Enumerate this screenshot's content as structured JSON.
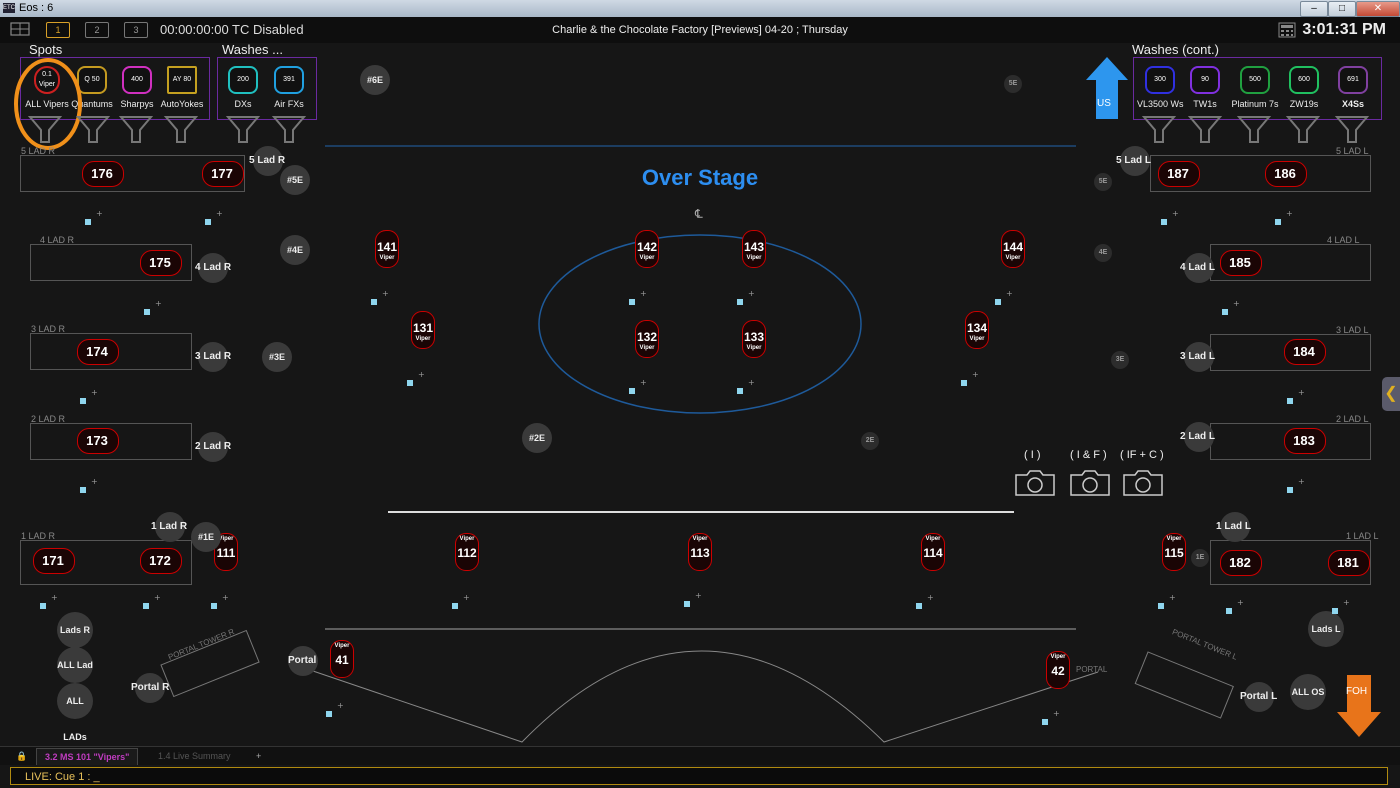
{
  "window": {
    "title": "Eos : 6",
    "logo": "ETC",
    "min_glyph": "–",
    "max_glyph": "□",
    "close_glyph": "✕"
  },
  "toolbar": {
    "tab1": "1",
    "tab2": "2",
    "tab3": "3",
    "timecode": "00:00:00:00 TC Disabled",
    "show_title": "Charlie & the Chocolate Factory [Previews] 04-20 ; Thursday",
    "clock": "3:01:31 PM"
  },
  "spots": {
    "header": "Spots",
    "items": [
      {
        "label": "ALL Vipers",
        "icon": "0.1\nViper",
        "color": "#cc2020"
      },
      {
        "label": "Quantums",
        "icon": "Q 50",
        "color": "#c49a20"
      },
      {
        "label": "Sharpys",
        "icon": "400",
        "color": "#d030c0"
      },
      {
        "label": "AutoYokes",
        "icon": "AY 80",
        "color": "#c4a020"
      }
    ]
  },
  "washes": {
    "header": "Washes ...",
    "items": [
      {
        "label": "DXs",
        "icon": "200 DX",
        "color": "#20c0c0"
      },
      {
        "label": "Air FXs",
        "icon": "391 Air FX",
        "color": "#20a0e0"
      }
    ]
  },
  "washes_cont": {
    "header": "Washes (cont.)",
    "items": [
      {
        "label": "VL3500 Ws",
        "icon": "300",
        "color": "#3030e0"
      },
      {
        "label": "TW1s",
        "icon": "TW1 90",
        "color": "#8030e0"
      },
      {
        "label": "Platinum 7s",
        "icon": "500",
        "color": "#20a040"
      },
      {
        "label": "ZW19s",
        "icon": "600 ZW",
        "color": "#20c060"
      },
      {
        "label": "X4Ss",
        "icon": "691",
        "color": "#8040a0"
      }
    ]
  },
  "stage": {
    "title": "Over Stage",
    "centerline": "℄",
    "us_label": "US",
    "foh_label": "FOH",
    "portal_tower_r": "PORTAL TOWER R",
    "portal_tower_l": "PORTAL TOWER L",
    "portal_text": "PORTAL",
    "collapse_glyph": "❮"
  },
  "ladders": {
    "r": [
      "5 LAD R",
      "4 LAD R",
      "3 LAD R",
      "2 LAD R",
      "1 LAD R"
    ],
    "l": [
      "5 LAD L",
      "4 LAD L",
      "3 LAD L",
      "2 LAD L",
      "1 LAD L"
    ]
  },
  "fixtures": {
    "f176": "176",
    "f177": "177",
    "f175": "175",
    "f174": "174",
    "f173": "173",
    "f171": "171",
    "f172": "172",
    "f187": "187",
    "f186": "186",
    "f185": "185",
    "f184": "184",
    "f183": "183",
    "f182": "182",
    "f181": "181",
    "f141": "141",
    "f142": "142",
    "f143": "143",
    "f144": "144",
    "f131": "131",
    "f132": "132",
    "f133": "133",
    "f134": "134",
    "f111": "111",
    "f112": "112",
    "f113": "113",
    "f114": "114",
    "f115": "115",
    "f41": "41",
    "f42": "42",
    "type": "Viper"
  },
  "groups": {
    "lad5r": "5 Lad R",
    "lad4r": "4 Lad R",
    "lad3r": "3 Lad R",
    "lad2r": "2 Lad R",
    "lad1r": "1 Lad R",
    "lad5l": "5 Lad L",
    "lad4l": "4 Lad L",
    "lad3l": "3 Lad L",
    "lad2l": "2 Lad L",
    "lad1l": "1 Lad L",
    "e6": "#6E",
    "e5": "#5E",
    "e4": "#4E",
    "e3": "#3E",
    "e2": "#2E",
    "e1": "#1E",
    "e6b": "5E",
    "e5b": "5E",
    "e4b": "4E",
    "e3b": "3E",
    "e2b": "2E",
    "e1b": "1E",
    "lads_r": "Lads R",
    "all_lad_v": "ALL Lad V",
    "all_lads": "ALL LADs",
    "portal_r": "Portal R",
    "portal": "Portal",
    "lads_l": "Lads L",
    "all_os": "ALL OS",
    "portal_l": "Portal L"
  },
  "cameras": [
    {
      "label": "( I )"
    },
    {
      "label": "( I & F )"
    },
    {
      "label": "( IF + C )"
    }
  ],
  "tabs": {
    "lock": "🔒",
    "t1": "3.2 MS 101 \"Vipers\"",
    "t2": "1.4 Live Summary",
    "add": "+"
  },
  "command_line": "LIVE: Cue  1 :  _"
}
